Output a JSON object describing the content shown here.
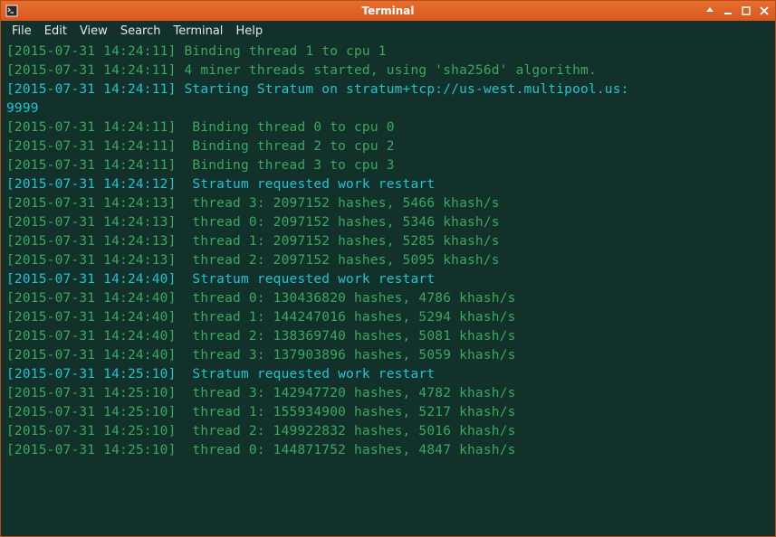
{
  "titlebar": {
    "title": "Terminal"
  },
  "menubar": {
    "items": [
      "File",
      "Edit",
      "View",
      "Search",
      "Terminal",
      "Help"
    ]
  },
  "log": {
    "lines": [
      {
        "ts": "[2015-07-31 14:24:11]",
        "msg": " Binding thread 1 to cpu 1",
        "hl": false
      },
      {
        "ts": "[2015-07-31 14:24:11]",
        "msg": " 4 miner threads started, using 'sha256d' algorithm.",
        "hl": false
      },
      {
        "ts": "[2015-07-31 14:24:11]",
        "msg": " Starting Stratum on stratum+tcp://us-west.multipool.us:",
        "hl": true,
        "cont": "9999"
      },
      {
        "ts": "[2015-07-31 14:24:11]",
        "msg": "  Binding thread 0 to cpu 0",
        "hl": false
      },
      {
        "ts": "[2015-07-31 14:24:11]",
        "msg": "  Binding thread 2 to cpu 2",
        "hl": false
      },
      {
        "ts": "[2015-07-31 14:24:11]",
        "msg": "  Binding thread 3 to cpu 3",
        "hl": false
      },
      {
        "ts": "[2015-07-31 14:24:12]",
        "msg": "  Stratum requested work restart",
        "hl": true
      },
      {
        "ts": "[2015-07-31 14:24:13]",
        "msg": "  thread 3: 2097152 hashes, 5466 khash/s",
        "hl": false
      },
      {
        "ts": "[2015-07-31 14:24:13]",
        "msg": "  thread 0: 2097152 hashes, 5346 khash/s",
        "hl": false
      },
      {
        "ts": "[2015-07-31 14:24:13]",
        "msg": "  thread 1: 2097152 hashes, 5285 khash/s",
        "hl": false
      },
      {
        "ts": "[2015-07-31 14:24:13]",
        "msg": "  thread 2: 2097152 hashes, 5095 khash/s",
        "hl": false
      },
      {
        "ts": "[2015-07-31 14:24:40]",
        "msg": "  Stratum requested work restart",
        "hl": true
      },
      {
        "ts": "[2015-07-31 14:24:40]",
        "msg": "  thread 0: 130436820 hashes, 4786 khash/s",
        "hl": false
      },
      {
        "ts": "[2015-07-31 14:24:40]",
        "msg": "  thread 1: 144247016 hashes, 5294 khash/s",
        "hl": false
      },
      {
        "ts": "[2015-07-31 14:24:40]",
        "msg": "  thread 2: 138369740 hashes, 5081 khash/s",
        "hl": false
      },
      {
        "ts": "[2015-07-31 14:24:40]",
        "msg": "  thread 3: 137903896 hashes, 5059 khash/s",
        "hl": false
      },
      {
        "ts": "[2015-07-31 14:25:10]",
        "msg": "  Stratum requested work restart",
        "hl": true
      },
      {
        "ts": "[2015-07-31 14:25:10]",
        "msg": "  thread 3: 142947720 hashes, 4782 khash/s",
        "hl": false
      },
      {
        "ts": "[2015-07-31 14:25:10]",
        "msg": "  thread 1: 155934900 hashes, 5217 khash/s",
        "hl": false
      },
      {
        "ts": "[2015-07-31 14:25:10]",
        "msg": "  thread 2: 149922832 hashes, 5016 khash/s",
        "hl": false
      },
      {
        "ts": "[2015-07-31 14:25:10]",
        "msg": "  thread 0: 144871752 hashes, 4847 khash/s",
        "hl": false
      }
    ]
  }
}
